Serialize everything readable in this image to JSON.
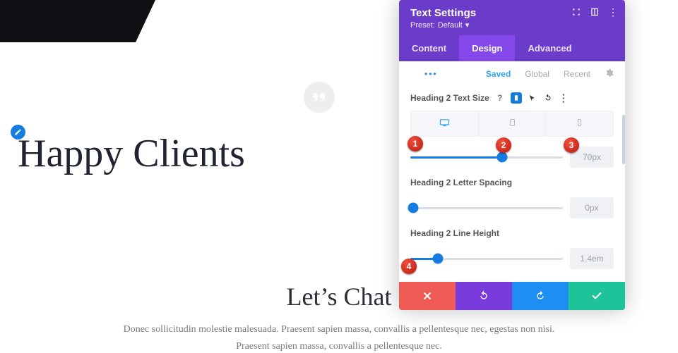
{
  "page": {
    "heading": "Happy Clients",
    "subheading": "Let’s Chat",
    "body": "Donec sollicitudin molestie malesuada. Praesent sapien massa, convallis a pellentesque nec, egestas non nisi. Praesent sapien massa, convallis a pellentesque nec."
  },
  "panel": {
    "title": "Text Settings",
    "preset_prefix": "Preset:",
    "preset_value": "Default",
    "tabs": [
      "Content",
      "Design",
      "Advanced"
    ],
    "active_tab": "Design",
    "subtabs": [
      "Saved",
      "Global",
      "Recent"
    ],
    "active_subtab": "Saved",
    "fields": {
      "size": {
        "label": "Heading 2 Text Size",
        "value": "70px",
        "slider_pct": 60
      },
      "spacing": {
        "label": "Heading 2 Letter Spacing",
        "value": "0px",
        "slider_pct": 2
      },
      "lineheight": {
        "label": "Heading 2 Line Height",
        "value": "1.4em",
        "slider_pct": 18
      }
    },
    "devices": [
      "desktop",
      "tablet",
      "phone"
    ],
    "active_device": "desktop",
    "footer_actions": [
      "cancel",
      "undo",
      "redo",
      "save"
    ]
  },
  "annotations": [
    "1",
    "2",
    "3",
    "4"
  ],
  "colors": {
    "purple": "#6b3cc9",
    "purple_active": "#8447ea",
    "blue": "#167de0",
    "red": "#ef5a55",
    "teal": "#1fc39a",
    "link_blue": "#2ea3f2"
  }
}
